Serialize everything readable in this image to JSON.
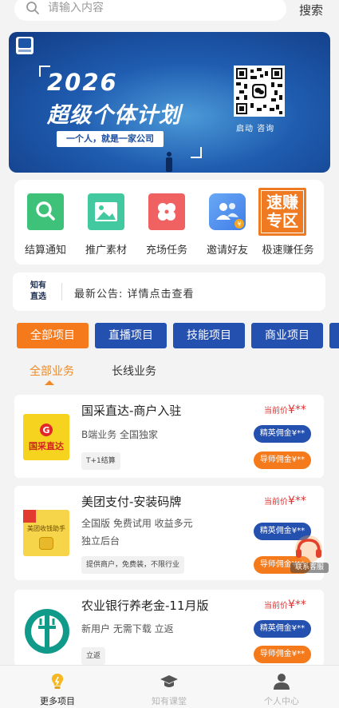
{
  "search": {
    "placeholder": "请输入内容",
    "button_label": "搜索"
  },
  "banner": {
    "year": "2026",
    "title": "超级个体计划",
    "subtitle": "一个人，就是一家公司",
    "qr_label": "启动 咨询"
  },
  "grid": {
    "items": [
      {
        "label": "结算通知",
        "icon": "search-icon",
        "color": "#3ec27a"
      },
      {
        "label": "推广素材",
        "icon": "image-icon",
        "color": "#43c9a0"
      },
      {
        "label": "充场任务",
        "icon": "clover-icon",
        "color": "#f06262"
      },
      {
        "label": "邀请好友",
        "icon": "users-icon",
        "color": "#4e8ff0"
      },
      {
        "label": "极速赚任务",
        "icon": "speed-earn-icon",
        "color": "#f07a22",
        "badge_text": "速赚专区"
      }
    ]
  },
  "notice": {
    "tag": "知有直选",
    "text": "最新公告: 详情点击查看"
  },
  "categories": [
    {
      "label": "全部项目",
      "active": true
    },
    {
      "label": "直播项目",
      "active": false
    },
    {
      "label": "技能项目",
      "active": false
    },
    {
      "label": "商业项目",
      "active": false
    }
  ],
  "sub_tabs": [
    {
      "label": "全部业务",
      "active": true
    },
    {
      "label": "长线业务",
      "active": false
    }
  ],
  "projects": [
    {
      "title": "国采直达-商户入驻",
      "desc": "B端业务  全国独家",
      "chip": "T+1结算",
      "price_label": "当前价",
      "price_value": "¥**",
      "elite_commission": "精英佣金¥**",
      "mentor_commission": "导师佣金¥**",
      "image_text": "国采直达"
    },
    {
      "title": "美团支付-安装码牌",
      "desc": "全国版  免费试用  收益多元  独立后台",
      "chip": "提供商户，免费装，不限行业",
      "price_label": "当前价",
      "price_value": "¥**",
      "elite_commission": "精英佣金¥**",
      "mentor_commission": "导师佣金¥**",
      "image_text": "美团收钱助手"
    },
    {
      "title": "农业银行养老金-11月版",
      "desc": "新用户  无需下载  立返",
      "chip": "立返",
      "price_label": "当前价",
      "price_value": "¥**",
      "elite_commission": "精英佣金¥**",
      "mentor_commission": "导师佣金¥**"
    }
  ],
  "float_contact": {
    "label": "联系客服"
  },
  "bottom_nav": [
    {
      "label": "更多项目",
      "icon": "bulb-icon",
      "active": true
    },
    {
      "label": "知有课堂",
      "icon": "graduation-cap-icon",
      "active": false
    },
    {
      "label": "个人中心",
      "icon": "user-icon",
      "active": false
    }
  ],
  "colors": {
    "accent_orange": "#f47a1c",
    "accent_blue": "#2450b0",
    "price_red": "#e03030"
  }
}
